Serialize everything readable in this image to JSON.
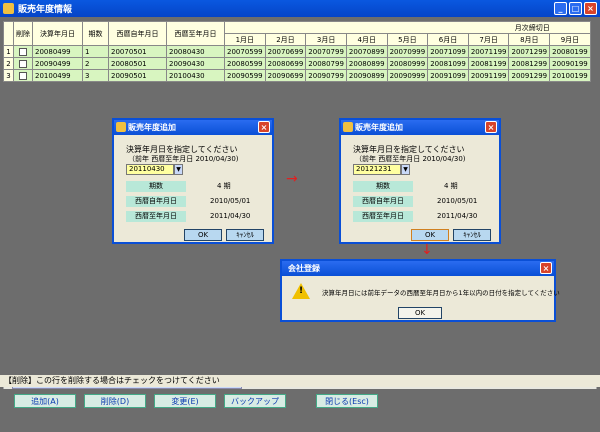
{
  "window": {
    "title": "販売年度情報",
    "min": "_",
    "max": "□",
    "close": "×"
  },
  "grid": {
    "headers": {
      "delete": "削除",
      "settle": "決算年月日",
      "period": "期数",
      "from": "西暦自年月日",
      "to": "西暦至年月日",
      "monthly": "月次締切日"
    },
    "months": [
      "1月日",
      "2月日",
      "3月日",
      "4月日",
      "5月日",
      "6月日",
      "7月日",
      "8月日",
      "9月日"
    ],
    "rows": [
      {
        "num": "1",
        "settle": "20080499",
        "period": "1",
        "from": "20070501",
        "to": "20080430",
        "m": [
          "20070599",
          "20070699",
          "20070799",
          "20070899",
          "20070999",
          "20071099",
          "20071199",
          "20071299",
          "20080199"
        ]
      },
      {
        "num": "2",
        "settle": "20090499",
        "period": "2",
        "from": "20080501",
        "to": "20090430",
        "m": [
          "20080599",
          "20080699",
          "20080799",
          "20080899",
          "20080999",
          "20081099",
          "20081199",
          "20081299",
          "20090199"
        ]
      },
      {
        "num": "3",
        "settle": "20100499",
        "period": "3",
        "from": "20090501",
        "to": "20100430",
        "m": [
          "20090599",
          "20090699",
          "20090799",
          "20090899",
          "20090999",
          "20091099",
          "20091199",
          "20091299",
          "20100199"
        ]
      }
    ]
  },
  "dialog1": {
    "title": "販売年度追加",
    "msg1": "決算年月日を指定してください",
    "msg2": "（前年 西暦至年月日 2010/04/30)",
    "input": "20110430",
    "l_period": "期数",
    "v_period": "4 期",
    "l_from": "西暦自年月日",
    "v_from": "2010/05/01",
    "l_to": "西暦至年月日",
    "v_to": "2011/04/30",
    "ok": "OK",
    "cancel": "ｷｬﾝｾﾙ"
  },
  "dialog2": {
    "title": "販売年度追加",
    "msg1": "決算年月日を指定してください",
    "msg2": "（前年 西暦至年月日 2010/04/30)",
    "input": "20121231",
    "l_period": "期数",
    "v_period": "4 期",
    "l_from": "西暦自年月日",
    "v_from": "2010/05/01",
    "l_to": "西暦至年月日",
    "v_to": "2011/04/30",
    "ok": "OK",
    "cancel": "ｷｬﾝｾﾙ"
  },
  "alert": {
    "title": "会社登録",
    "message": "決算年月日には前年データの西暦至年月日から1年以内の日付を指定してください",
    "ok": "OK"
  },
  "status": "【削除】この行を削除する場合はチェックをつけてください",
  "buttons": {
    "add": "追加(A)",
    "delete": "削除(D)",
    "change": "変更(E)",
    "backup": "バックアップ",
    "close": "閉じる(Esc)"
  }
}
